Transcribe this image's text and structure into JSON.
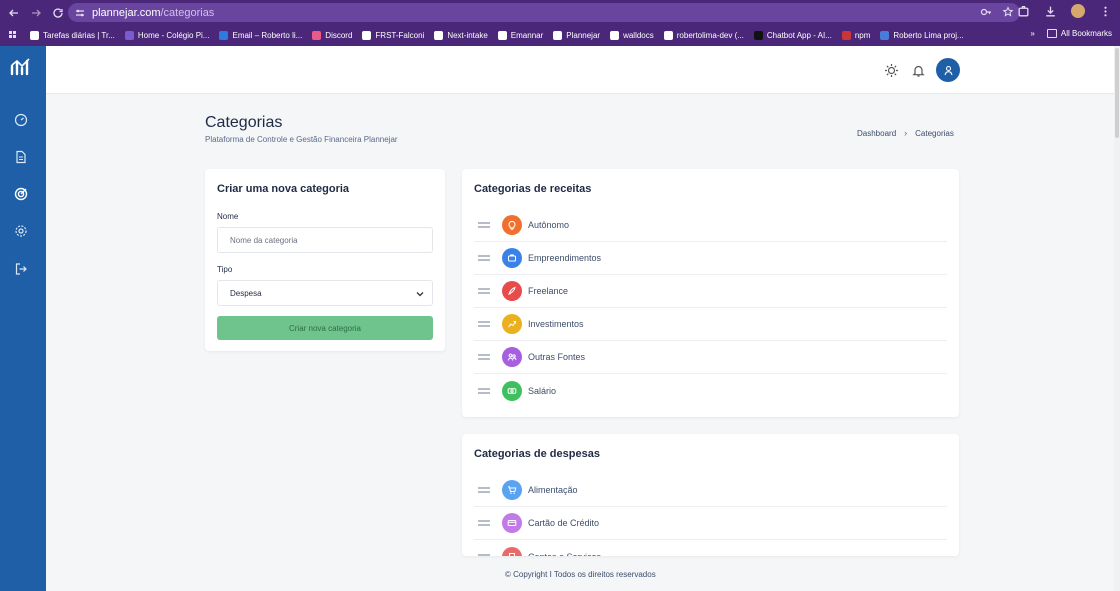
{
  "browser": {
    "url_host": "plannejar.com",
    "url_path": "/categorias",
    "bookmarks": [
      {
        "label": "Tarefas diárias | Tr...",
        "color": "#ffffff"
      },
      {
        "label": "Home - Colégio Pi...",
        "color": "#7a5bd0"
      },
      {
        "label": "Email – Roberto li...",
        "color": "#2d7be0"
      },
      {
        "label": "Discord",
        "color": "#e85a8a"
      },
      {
        "label": "FRST-Falconi",
        "color": "#ffffff"
      },
      {
        "label": "Next-intake",
        "color": "#ffffff"
      },
      {
        "label": "Emannar",
        "color": "#ffffff"
      },
      {
        "label": "Plannejar",
        "color": "#ffffff"
      },
      {
        "label": "walldocs",
        "color": "#ffffff"
      },
      {
        "label": "robertolima-dev (...",
        "color": "#ffffff"
      },
      {
        "label": "Chatbot App - AI...",
        "color": "#111111"
      },
      {
        "label": "npm",
        "color": "#c8353b"
      },
      {
        "label": "Roberto Lima proj...",
        "color": "#4a7bd8"
      }
    ],
    "all_bookmarks_label": "All Bookmarks"
  },
  "page": {
    "title": "Categorias",
    "subtitle": "Plataforma de Controle e Gestão Financeira Plannejar",
    "breadcrumb": [
      "Dashboard",
      "Categorias"
    ]
  },
  "create_form": {
    "title": "Criar uma nova categoria",
    "name_label": "Nome",
    "name_placeholder": "Nome da categoria",
    "type_label": "Tipo",
    "type_value": "Despesa",
    "submit_label": "Criar nova categoria"
  },
  "income": {
    "title": "Categorias de receitas",
    "items": [
      {
        "label": "Autônomo",
        "color": "#f0712f",
        "icon": "lightbulb-icon"
      },
      {
        "label": "Empreendimentos",
        "color": "#3b82e6",
        "icon": "briefcase-icon"
      },
      {
        "label": "Freelance",
        "color": "#e84b4b",
        "icon": "rocket-icon"
      },
      {
        "label": "Investimentos",
        "color": "#ebb01e",
        "icon": "trending-up-icon"
      },
      {
        "label": "Outras Fontes",
        "color": "#a55fe0",
        "icon": "users-icon"
      },
      {
        "label": "Salário",
        "color": "#3fbf5e",
        "icon": "money-icon"
      }
    ]
  },
  "expenses": {
    "title": "Categorias de despesas",
    "items": [
      {
        "label": "Alimentação",
        "color": "#5aa3f0",
        "icon": "cart-icon"
      },
      {
        "label": "Cartão de Crédito",
        "color": "#c27ae6",
        "icon": "credit-card-icon"
      },
      {
        "label": "Contas e Serviços",
        "color": "#e86a6a",
        "icon": "bill-icon"
      }
    ]
  },
  "footer": {
    "text": "© Copyright I Todos os direitos reservados"
  },
  "colors": {
    "sidebar": "#1f5fa8",
    "chrome": "#4a2778",
    "submit": "#6fc48d"
  }
}
